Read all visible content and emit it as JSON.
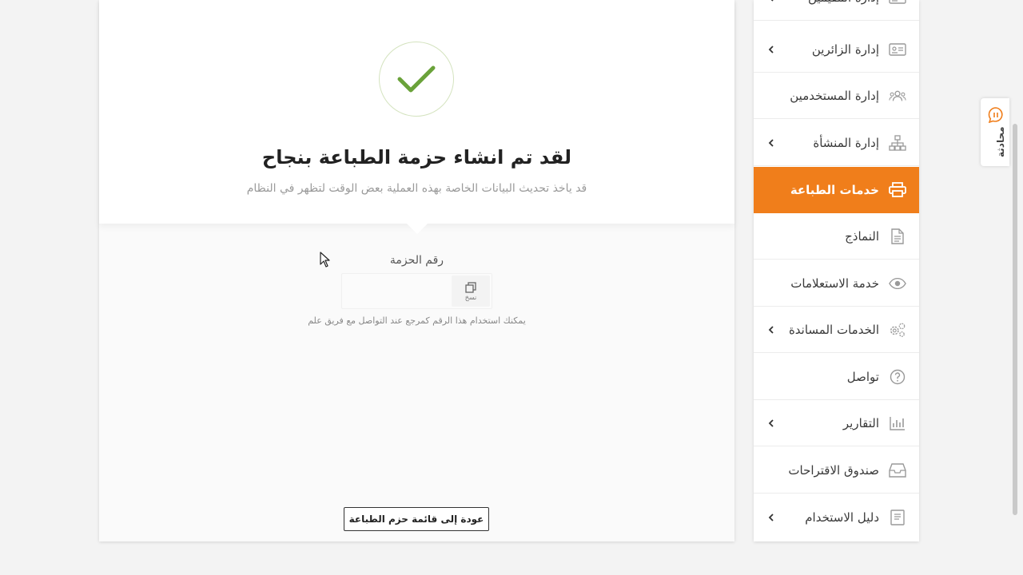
{
  "success": {
    "title": "لقد تم انشاء حزمة الطباعة بنجاح",
    "subtitle": "قد ياخذ تحديث البيانات الخاصة بهذه العملية بعض الوقت لتظهر في النظام"
  },
  "package": {
    "label": "رقم الحزمة",
    "value": "",
    "copy_label": "نسخ",
    "hint": "يمكنك استخدام هذا الرقم كمرجع عند التواصل مع فريق علم"
  },
  "back_button": "عودة إلى قائمة حزم الطباعة",
  "chat_label": "محادثة",
  "sidebar": {
    "items": [
      {
        "label": "إدارة المقيمين",
        "icon": "id-card-icon",
        "chevron": true
      },
      {
        "label": "إدارة الزائرين",
        "icon": "visitor-card-icon",
        "chevron": true
      },
      {
        "label": "إدارة المستخدمين",
        "icon": "users-icon",
        "chevron": false
      },
      {
        "label": "إدارة المنشأة",
        "icon": "org-chart-icon",
        "chevron": true
      },
      {
        "label": "خدمات الطباعة",
        "icon": "printer-icon",
        "chevron": false,
        "active": true
      },
      {
        "label": "النماذج",
        "icon": "document-icon",
        "chevron": false
      },
      {
        "label": "خدمة الاستعلامات",
        "icon": "eye-icon",
        "chevron": false
      },
      {
        "label": "الخدمات المساندة",
        "icon": "gears-icon",
        "chevron": true
      },
      {
        "label": "تواصل",
        "icon": "question-icon",
        "chevron": false
      },
      {
        "label": "التقارير",
        "icon": "bar-chart-icon",
        "chevron": true
      },
      {
        "label": "صندوق الاقتراحات",
        "icon": "inbox-icon",
        "chevron": false
      },
      {
        "label": "دليل الاستخدام",
        "icon": "manual-icon",
        "chevron": true
      }
    ]
  },
  "colors": {
    "accent": "#f07e1b",
    "success_green": "#6aa23a"
  }
}
